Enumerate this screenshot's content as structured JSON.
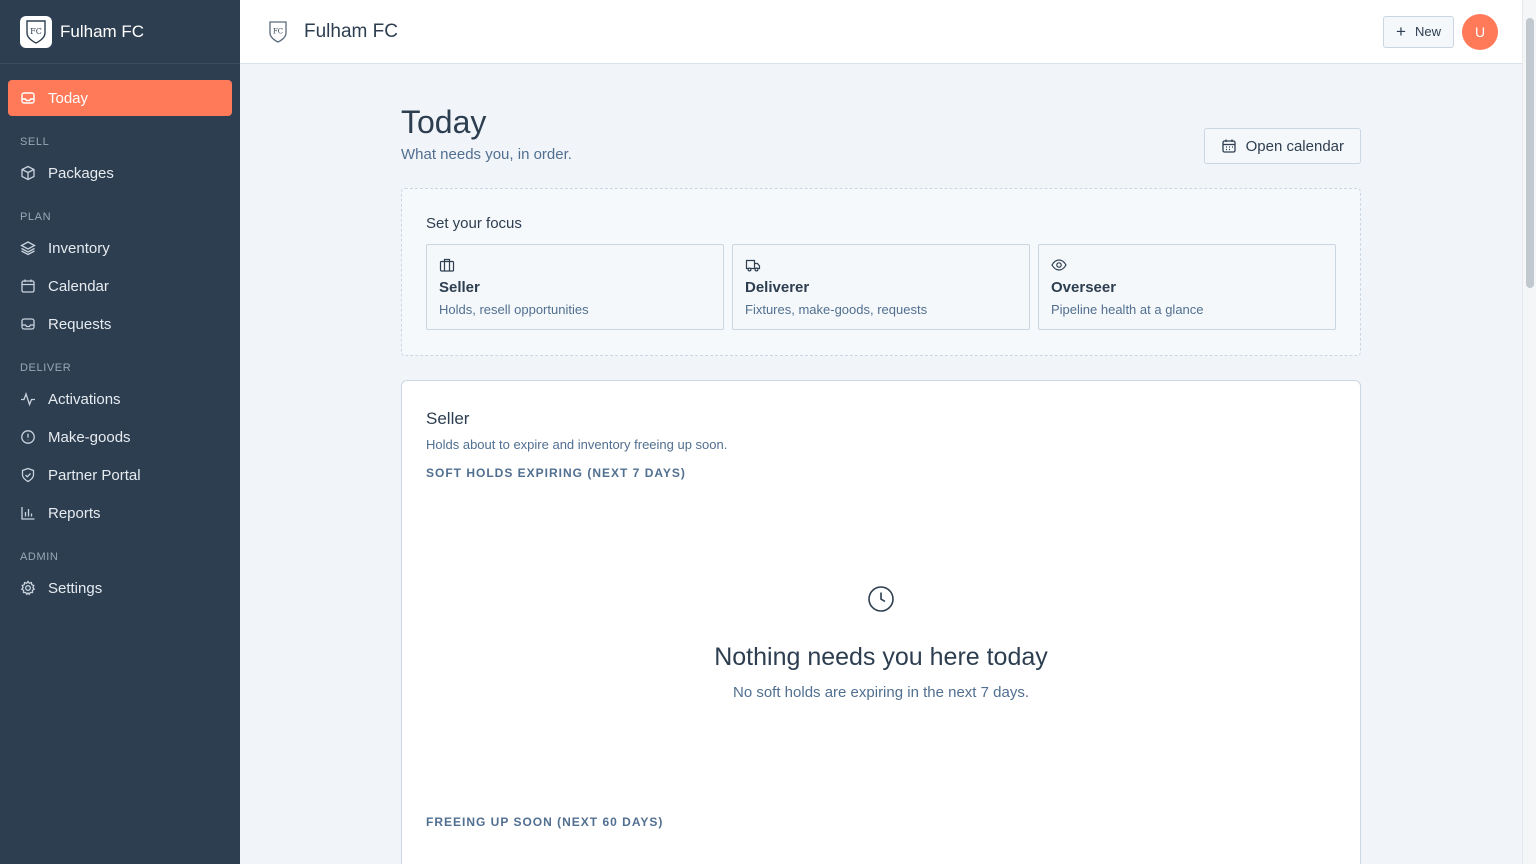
{
  "app": {
    "club_name": "Fulham FC",
    "crest_text": "FC"
  },
  "sidebar": {
    "today": "Today",
    "sections": {
      "sell": "SELL",
      "plan": "PLAN",
      "deliver": "DELIVER",
      "admin": "ADMIN"
    },
    "items": {
      "packages": "Packages",
      "inventory": "Inventory",
      "calendar": "Calendar",
      "requests": "Requests",
      "activations": "Activations",
      "makegoods": "Make-goods",
      "partner_portal": "Partner Portal",
      "reports": "Reports",
      "settings": "Settings"
    }
  },
  "topbar": {
    "title": "Fulham FC",
    "new_label": "New",
    "avatar_initial": "U"
  },
  "page": {
    "title": "Today",
    "subtitle": "What needs you, in order.",
    "open_calendar": "Open calendar"
  },
  "focus": {
    "title": "Set your focus",
    "options": [
      {
        "title": "Seller",
        "desc": "Holds, resell opportunities",
        "icon": "briefcase-icon"
      },
      {
        "title": "Deliverer",
        "desc": "Fixtures, make-goods, requests",
        "icon": "truck-icon"
      },
      {
        "title": "Overseer",
        "desc": "Pipeline health at a glance",
        "icon": "eye-icon"
      }
    ]
  },
  "seller": {
    "title": "Seller",
    "subtitle": "Holds about to expire and inventory freeing up soon.",
    "soft_holds_label": "SOFT HOLDS EXPIRING (NEXT 7 DAYS)",
    "empty_title": "Nothing needs you here today",
    "empty_sub": "No soft holds are expiring in the next 7 days.",
    "freeing_label": "FREEING UP SOON (NEXT 60 DAYS)"
  },
  "colors": {
    "accent": "#ff7a59",
    "sidebar": "#2d3e50",
    "background": "#f1f5f9"
  }
}
